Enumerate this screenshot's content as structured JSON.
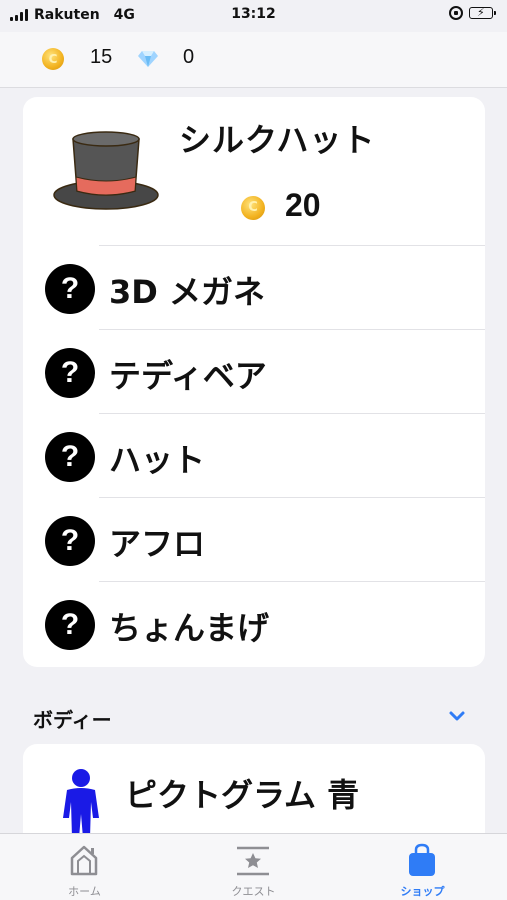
{
  "status_bar": {
    "carrier": "Rakuten",
    "network": "4G",
    "time": "13:12",
    "battery_level": 0.4
  },
  "currency": {
    "coin_icon": "coin-icon",
    "coins": "15",
    "gem_icon": "diamond-icon",
    "gems": "0"
  },
  "featured": {
    "icon": "silk-hat-icon",
    "name": "シルクハット",
    "price": "20"
  },
  "items": [
    {
      "label": "3D メガネ",
      "icon": "question-icon"
    },
    {
      "label": "テディベア",
      "icon": "question-icon"
    },
    {
      "label": "ハット",
      "icon": "question-icon"
    },
    {
      "label": "アフロ",
      "icon": "question-icon"
    },
    {
      "label": "ちょんまげ",
      "icon": "question-icon"
    }
  ],
  "question_mark": "?",
  "section": {
    "title": "ボディー",
    "icon": "chevron-down-icon"
  },
  "body_item": {
    "icon": "pictogram-person-icon",
    "name": "ピクトグラム 青"
  },
  "tabs": [
    {
      "label": "ホーム",
      "icon": "home-icon",
      "active": false
    },
    {
      "label": "クエスト",
      "icon": "quest-star-icon",
      "active": false
    },
    {
      "label": "ショップ",
      "icon": "shopping-bag-icon",
      "active": true
    }
  ],
  "colors": {
    "accent": "#2f7cf6",
    "coin": "#f2b21f",
    "background": "#f1f1f5",
    "hat_band": "#e56b5d",
    "pictogram": "#1a1ae6"
  }
}
